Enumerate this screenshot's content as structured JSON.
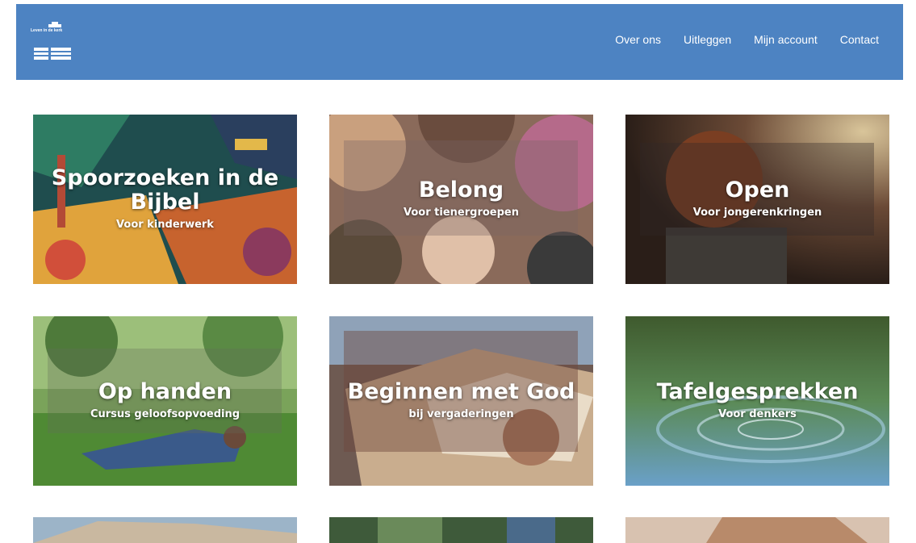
{
  "header": {
    "logo_text": "Leven in de kerk",
    "nav": [
      "Over ons",
      "Uitleggen",
      "Mijn account",
      "Contact"
    ]
  },
  "tiles": [
    {
      "title": "Spoorzoeken in de Bijbel",
      "subtitle": "Voor kinderwerk"
    },
    {
      "title": "Belong",
      "subtitle": "Voor tienergroepen"
    },
    {
      "title": "Open",
      "subtitle": "Voor jongerenkringen"
    },
    {
      "title": "Op handen",
      "subtitle": "Cursus geloofsopvoeding"
    },
    {
      "title": "Beginnen met God",
      "subtitle": "bij vergaderingen"
    },
    {
      "title": "Tafelgesprekken",
      "subtitle": "Voor denkers"
    }
  ],
  "colors": {
    "header_bg": "#4d83c2",
    "page_bg": "#ffffff",
    "text_on_image": "#ffffff"
  }
}
